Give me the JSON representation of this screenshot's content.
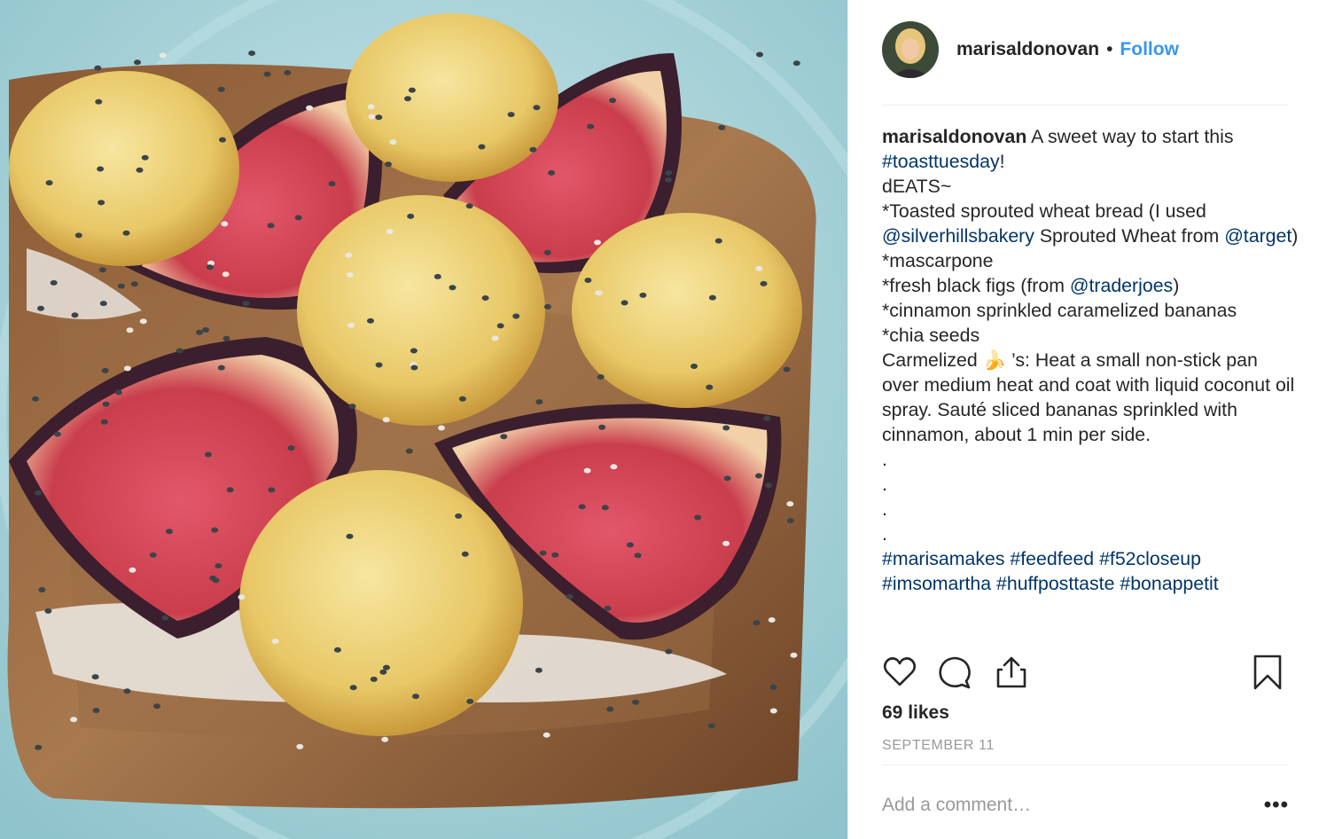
{
  "post": {
    "username": "marisaldonovan",
    "separator": "•",
    "follow_label": "Follow",
    "caption": [
      {
        "t": "text",
        "v": "A sweet way to start this "
      },
      {
        "t": "link",
        "v": "#toasttuesday"
      },
      {
        "t": "text",
        "v": "!\ndEATS~\n*Toasted sprouted wheat bread (I used "
      },
      {
        "t": "link",
        "v": "@silverhillsbakery"
      },
      {
        "t": "text",
        "v": " Sprouted Wheat from "
      },
      {
        "t": "link",
        "v": "@target"
      },
      {
        "t": "text",
        "v": ")\n*mascarpone\n*fresh black figs (from "
      },
      {
        "t": "link",
        "v": "@traderjoes"
      },
      {
        "t": "text",
        "v": ")\n*cinnamon sprinkled caramelized bananas\n*chia seeds\nCarmelized 🍌 ’s: Heat a small non-stick pan over medium heat and coat with liquid coconut oil spray. Sauté sliced bananas sprinkled with cinnamon, about 1 min per side.\n.\n.\n.\n.\n"
      },
      {
        "t": "link",
        "v": "#marisamakes"
      },
      {
        "t": "text",
        "v": " "
      },
      {
        "t": "link",
        "v": "#feedfeed"
      },
      {
        "t": "text",
        "v": " "
      },
      {
        "t": "link",
        "v": "#f52closeup"
      },
      {
        "t": "text",
        "v": " "
      },
      {
        "t": "link",
        "v": "#imsomartha"
      },
      {
        "t": "text",
        "v": " "
      },
      {
        "t": "link",
        "v": "#huffposttaste"
      },
      {
        "t": "text",
        "v": " "
      },
      {
        "t": "link",
        "v": "#bonappetit"
      }
    ],
    "likes_label": "69 likes",
    "date": "SEPTEMBER 11",
    "comment_placeholder": "Add a comment…",
    "more_label": "•••"
  },
  "icons": {
    "like": "heart-icon",
    "comment": "comment-bubble-icon",
    "share": "share-icon",
    "save": "bookmark-icon",
    "more": "more-options-icon"
  },
  "colors": {
    "follow": "#3897f0",
    "link": "#003569",
    "muted": "#999999",
    "divider": "#efefef",
    "plate": "#a9d3d9"
  }
}
